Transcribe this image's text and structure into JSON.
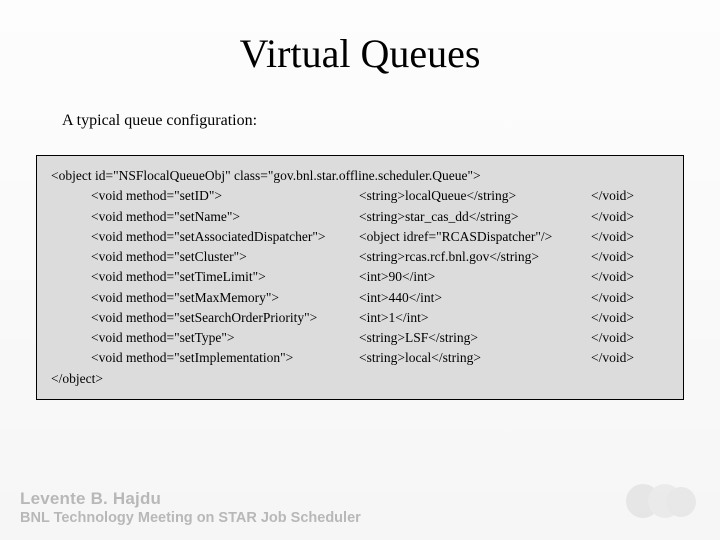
{
  "title": "Virtual Queues",
  "subtitle": "A typical queue configuration:",
  "code": {
    "open": "<object id=\"NSFlocalQueueObj\" class=\"gov.bnl.star.offline.scheduler.Queue\">",
    "rows": [
      {
        "method": "<void method=\"setID\">",
        "value": "<string>localQueue</string>",
        "close": "</void>"
      },
      {
        "method": "<void method=\"setName\">",
        "value": "<string>star_cas_dd</string>",
        "close": "</void>"
      },
      {
        "method": "<void method=\"setAssociatedDispatcher\">",
        "value": "<object idref=\"RCASDispatcher\"/>",
        "close": "</void>"
      },
      {
        "method": "<void method=\"setCluster\">",
        "value": "<string>rcas.rcf.bnl.gov</string>",
        "close": "</void>"
      },
      {
        "method": "<void method=\"setTimeLimit\">",
        "value": "<int>90</int>",
        "close": "</void>"
      },
      {
        "method": "<void method=\"setMaxMemory\">",
        "value": "<int>440</int>",
        "close": "</void>"
      },
      {
        "method": "<void method=\"setSearchOrderPriority\">",
        "value": "<int>1</int>",
        "close": "</void>"
      },
      {
        "method": "<void method=\"setType\">",
        "value": "<string>LSF</string>",
        "close": "</void>"
      },
      {
        "method": "<void method=\"setImplementation\">",
        "value": "<string>local</string>",
        "close": "</void>"
      }
    ],
    "close": "</object>"
  },
  "footer": {
    "author": "Levente B. Hajdu",
    "meeting": "BNL Technology Meeting on STAR Job Scheduler"
  }
}
